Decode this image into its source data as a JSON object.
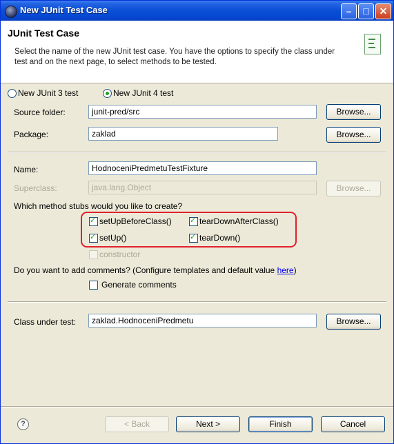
{
  "window": {
    "title": "New JUnit Test Case"
  },
  "header": {
    "title": "JUnit Test Case",
    "description": "Select the name of the new JUnit test case. You have the options to specify the class under test and on the next page, to select methods to be tested."
  },
  "junit_version": {
    "option3": "New JUnit 3 test",
    "option4": "New JUnit 4 test",
    "selected": "New JUnit 4 test"
  },
  "form": {
    "source_folder_label": "Source folder:",
    "source_folder_value": "junit-pred/src",
    "package_label": "Package:",
    "package_value": "zaklad",
    "name_label": "Name:",
    "name_value": "HodnoceniPredmetuTestFixture",
    "superclass_label": "Superclass:",
    "superclass_value": "java.lang.Object",
    "class_under_test_label": "Class under test:",
    "class_under_test_value": "zaklad.HodnoceniPredmetu",
    "browse_label": "Browse..."
  },
  "stubs": {
    "question": "Which method stubs would you like to create?",
    "setUpBeforeClass": {
      "label": "setUpBeforeClass()",
      "checked": true
    },
    "tearDownAfterClass": {
      "label": "tearDownAfterClass()",
      "checked": true
    },
    "setUp": {
      "label": "setUp()",
      "checked": true
    },
    "tearDown": {
      "label": "tearDown()",
      "checked": true
    },
    "constructor": {
      "label": "constructor",
      "checked": false,
      "enabled": false
    }
  },
  "comments": {
    "question_prefix": "Do you want to add comments? (Configure templates and default value ",
    "link": "here",
    "question_suffix": ")",
    "generate_label": "Generate comments",
    "generate_checked": false
  },
  "buttons": {
    "back": "< Back",
    "next": "Next >",
    "finish": "Finish",
    "cancel": "Cancel"
  },
  "icons": {
    "title": "eclipse-icon",
    "header": "junit-wizard-icon",
    "help": "help-icon"
  }
}
